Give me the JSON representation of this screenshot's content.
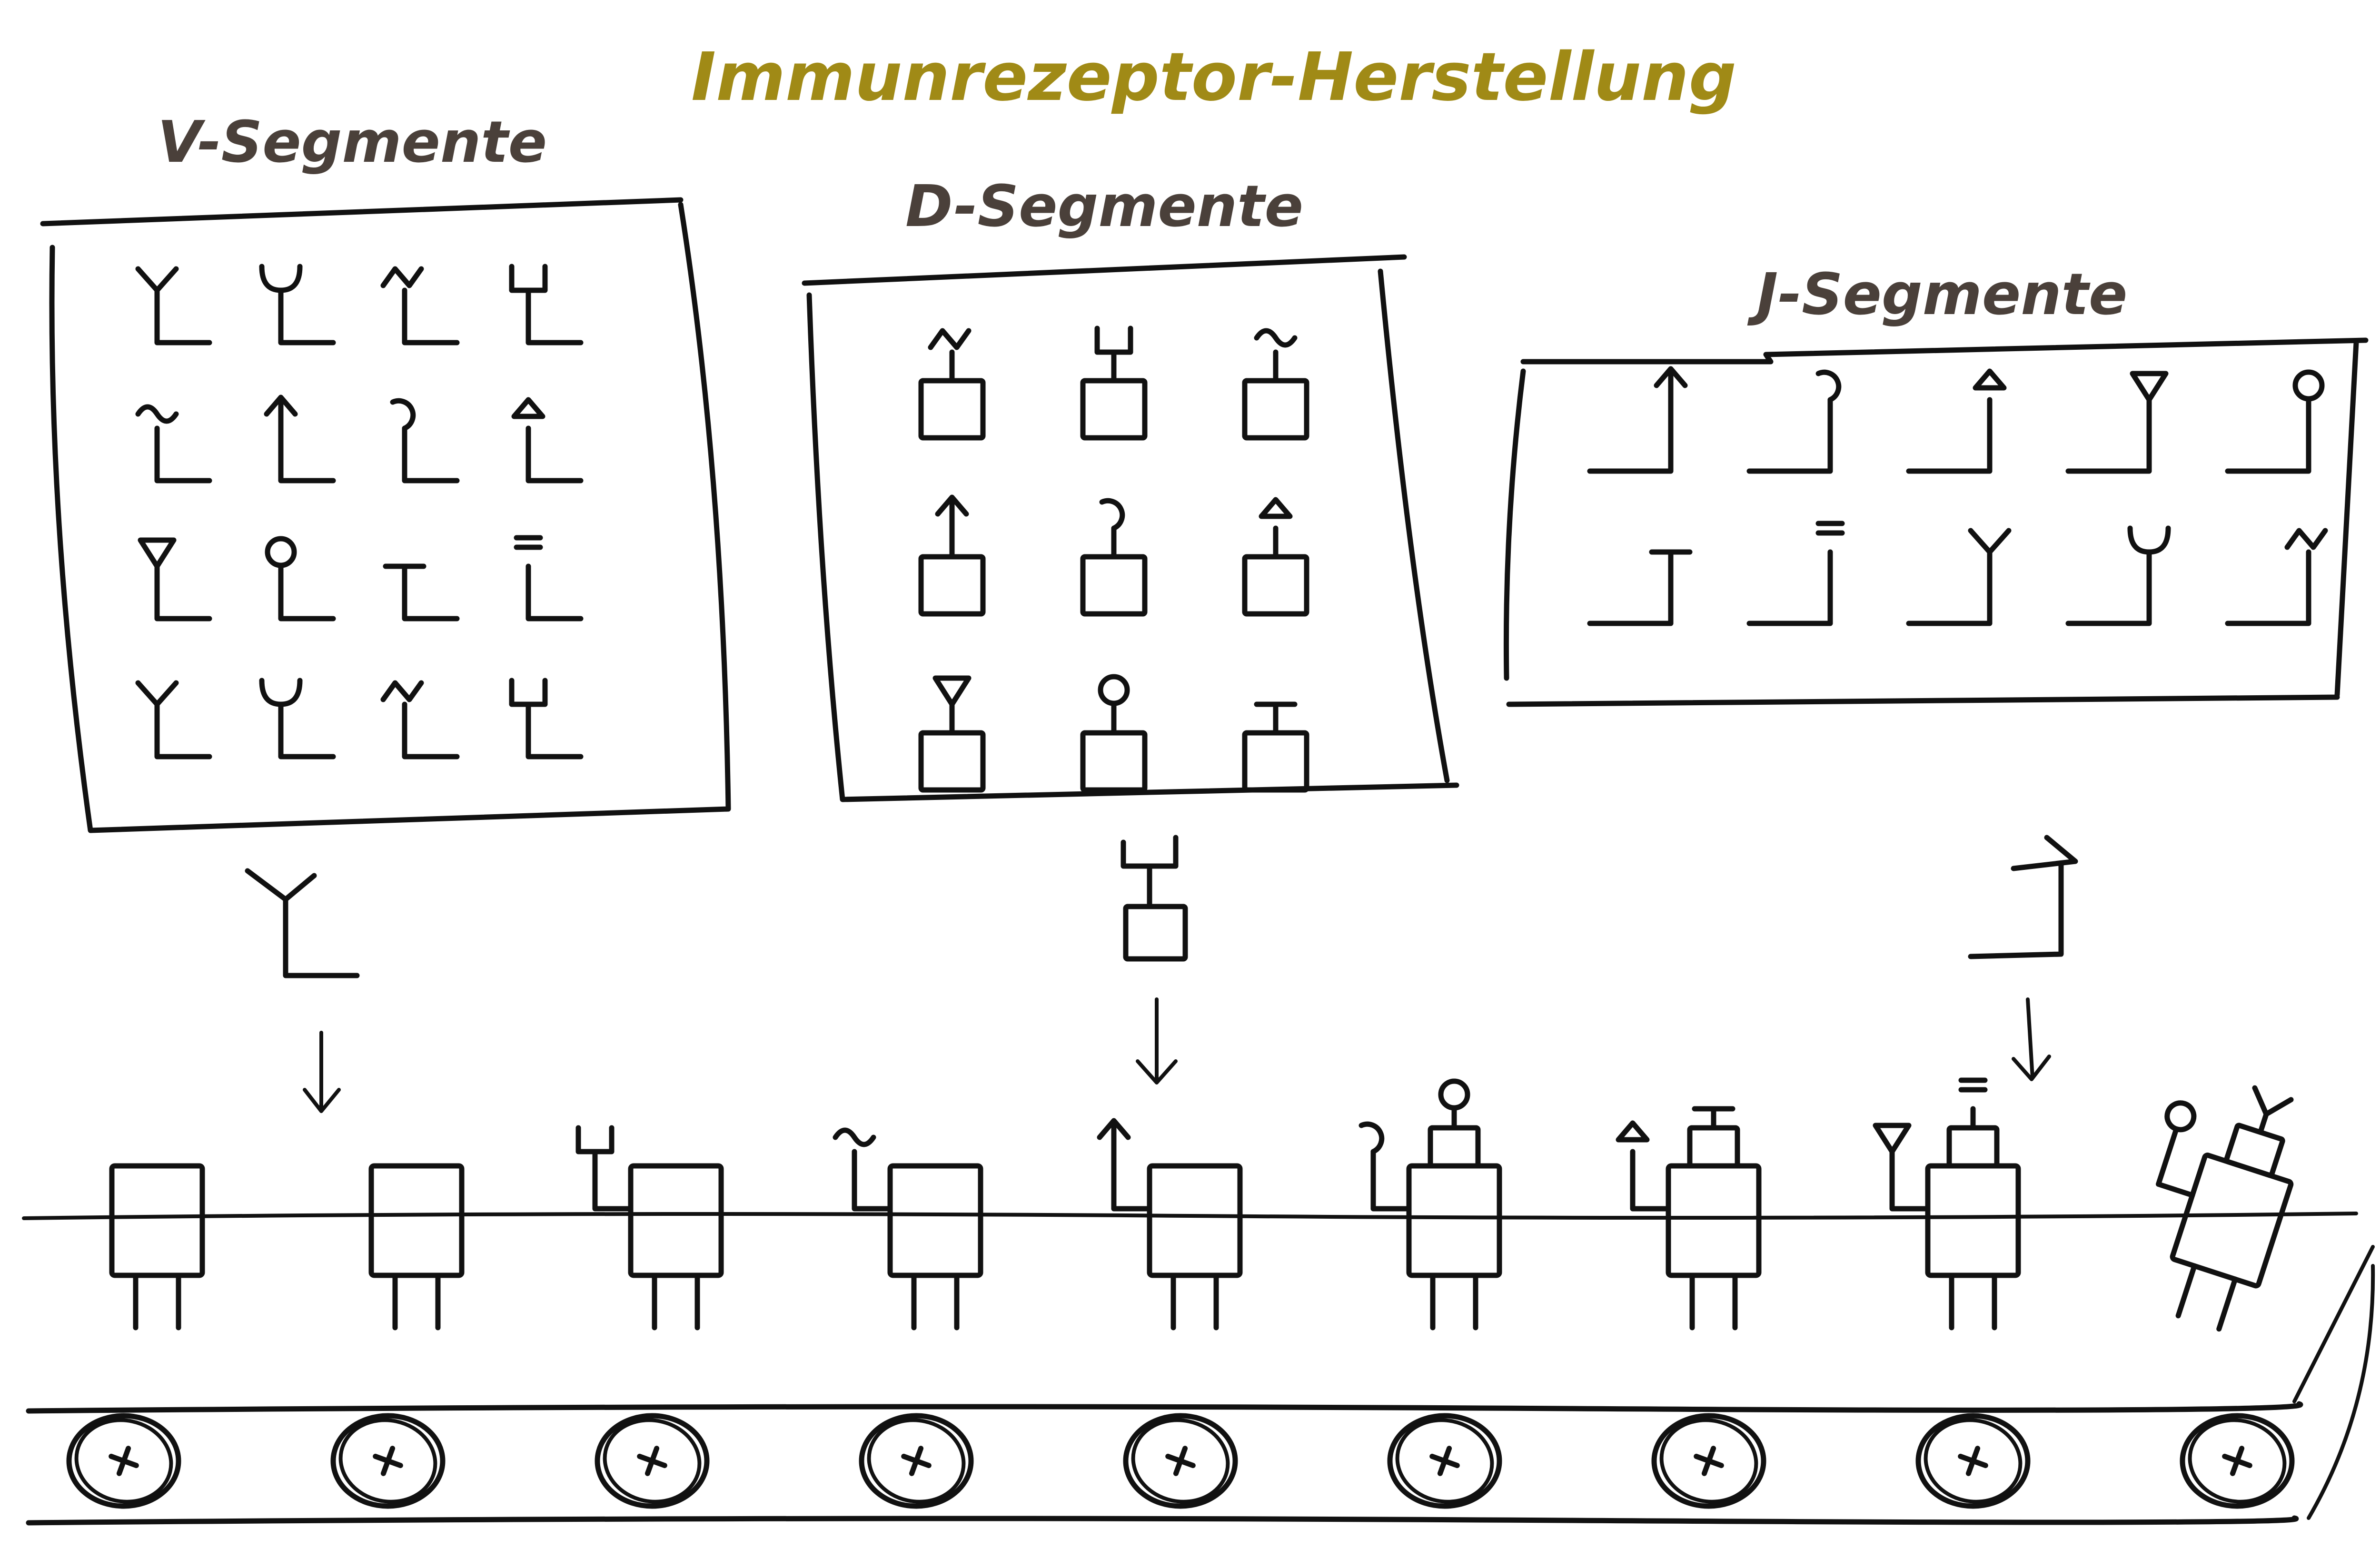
{
  "title": "Immunrezeptor-Herstellung",
  "colors": {
    "title": "#a08a16",
    "label": "#4a403a",
    "ink": "#111111",
    "background": "#ffffff"
  },
  "panels": {
    "v": {
      "label": "V-Segmente",
      "item_count": 16
    },
    "d": {
      "label": "D-Segmente",
      "item_count": 9
    },
    "j": {
      "label": "J-Segmente",
      "item_count": 10
    }
  },
  "assembly_line": {
    "robot_count": 9,
    "roller_count": 9,
    "drop_arrows": [
      "v",
      "d",
      "j"
    ]
  }
}
